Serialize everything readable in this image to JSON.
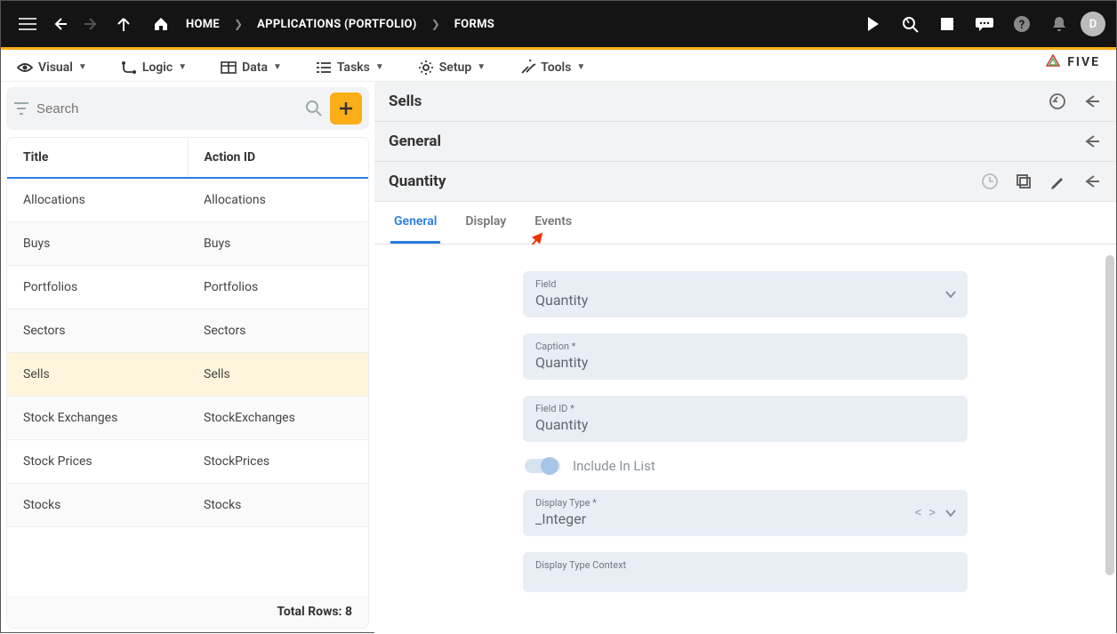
{
  "topbar": {
    "breadcrumb": [
      {
        "label": "HOME",
        "has_home_icon": true
      },
      {
        "label": "APPLICATIONS (PORTFOLIO)"
      },
      {
        "label": "FORMS"
      }
    ],
    "avatar_initial": "D"
  },
  "menubar": {
    "items": [
      {
        "label": "Visual",
        "icon": "eye"
      },
      {
        "label": "Logic",
        "icon": "route"
      },
      {
        "label": "Data",
        "icon": "table"
      },
      {
        "label": "Tasks",
        "icon": "tasks"
      },
      {
        "label": "Setup",
        "icon": "gear"
      },
      {
        "label": "Tools",
        "icon": "wrench"
      }
    ],
    "brand": "FIVE"
  },
  "search": {
    "placeholder": "Search"
  },
  "table": {
    "headers": {
      "title": "Title",
      "action_id": "Action ID"
    },
    "rows": [
      {
        "title": "Allocations",
        "action_id": "Allocations"
      },
      {
        "title": "Buys",
        "action_id": "Buys"
      },
      {
        "title": "Portfolios",
        "action_id": "Portfolios"
      },
      {
        "title": "Sectors",
        "action_id": "Sectors"
      },
      {
        "title": "Sells",
        "action_id": "Sells",
        "selected": true
      },
      {
        "title": "Stock Exchanges",
        "action_id": "StockExchanges"
      },
      {
        "title": "Stock Prices",
        "action_id": "StockPrices"
      },
      {
        "title": "Stocks",
        "action_id": "Stocks"
      }
    ],
    "footer": "Total Rows: 8"
  },
  "right": {
    "title_1": "Sells",
    "title_2": "General",
    "title_3": "Quantity",
    "tabs": [
      {
        "label": "General",
        "active": true
      },
      {
        "label": "Display"
      },
      {
        "label": "Events"
      }
    ],
    "fields": {
      "field": {
        "label": "Field",
        "value": "Quantity"
      },
      "caption": {
        "label": "Caption *",
        "value": "Quantity"
      },
      "field_id": {
        "label": "Field ID *",
        "value": "Quantity"
      },
      "include_in_list": {
        "label": "Include In List",
        "enabled": true
      },
      "display_type": {
        "label": "Display Type *",
        "value": "_Integer"
      },
      "display_context": {
        "label": "Display Type Context",
        "value": ""
      }
    }
  }
}
